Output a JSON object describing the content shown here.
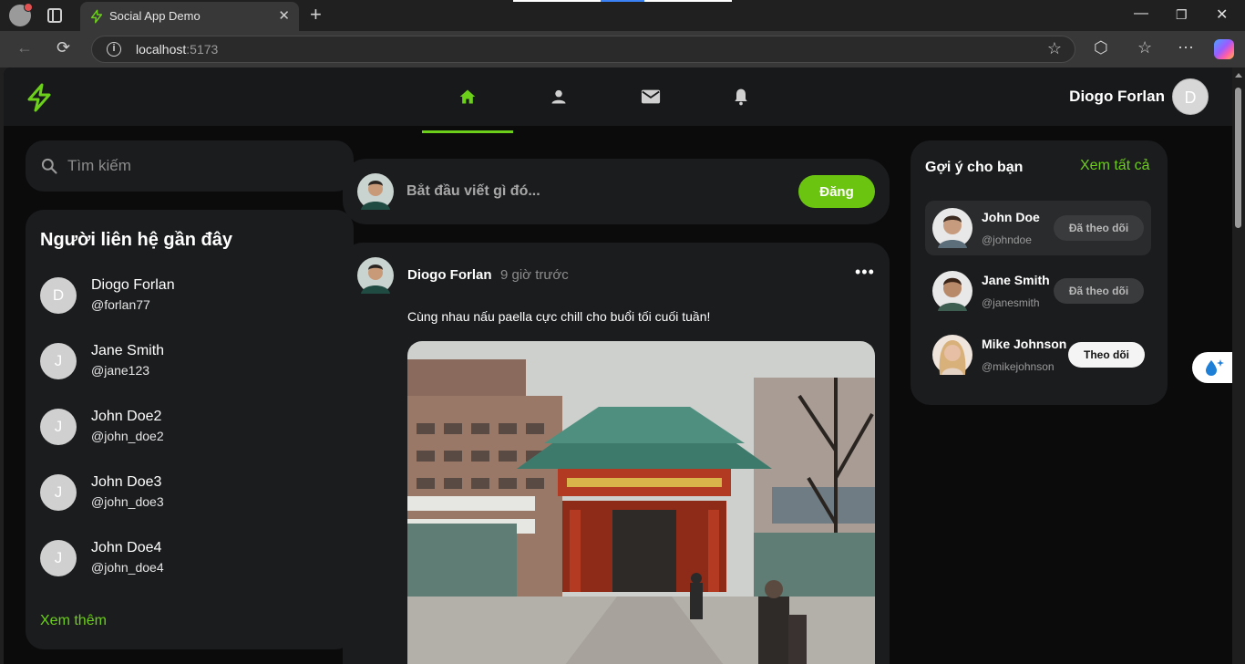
{
  "browser": {
    "tab_title": "Social App Demo",
    "url_host": "localhost",
    "url_port": ":5173"
  },
  "header": {
    "user_name": "Diogo Forlan",
    "user_initial": "D",
    "nav": [
      "home-icon",
      "profile-icon",
      "mail-icon",
      "bell-icon"
    ],
    "accent": "#6ccf1a"
  },
  "search": {
    "placeholder": "Tìm kiếm"
  },
  "contacts": {
    "title": "Người liên hệ gần đây",
    "items": [
      {
        "initial": "D",
        "name": "Diogo Forlan",
        "handle": "@forlan77"
      },
      {
        "initial": "J",
        "name": "Jane Smith",
        "handle": "@jane123"
      },
      {
        "initial": "J",
        "name": "John Doe2",
        "handle": "@john_doe2"
      },
      {
        "initial": "J",
        "name": "John Doe3",
        "handle": "@john_doe3"
      },
      {
        "initial": "J",
        "name": "John Doe4",
        "handle": "@john_doe4"
      }
    ],
    "see_more": "Xem thêm"
  },
  "composer": {
    "placeholder": "Bắt đầu viết gì đó...",
    "post_label": "Đăng"
  },
  "post": {
    "author": "Diogo Forlan",
    "time": "9 giờ trước",
    "more": "•••",
    "text": "Cùng nhau nấu paella cực chill cho buổi tối cuối tuần!"
  },
  "suggestions": {
    "title": "Gợi ý cho bạn",
    "see_all": "Xem tất cả",
    "items": [
      {
        "name": "John Doe",
        "handle": "@johndoe",
        "button": "Đã theo dõi"
      },
      {
        "name": "Jane Smith",
        "handle": "@janesmith",
        "button": "Đã theo dõi"
      },
      {
        "name": "Mike Johnson",
        "handle": "@mikejohnson",
        "button": "Theo dõi"
      }
    ]
  }
}
